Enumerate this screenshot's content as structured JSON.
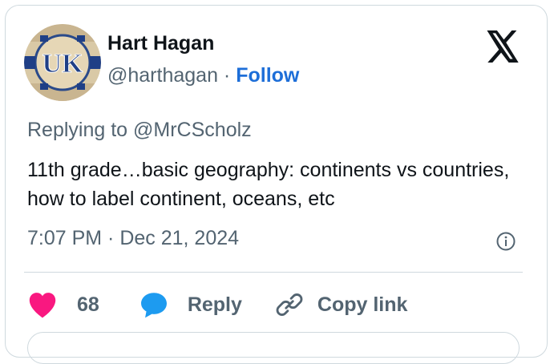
{
  "author": {
    "name": "Hart Hagan",
    "handle": "@harthagan",
    "separator": " · ",
    "follow_label": "Follow",
    "avatar_text": "UK"
  },
  "logo_icon": "x-logo-icon",
  "reply_context": {
    "prefix": "Replying to ",
    "mention": "@MrCScholz"
  },
  "tweet": {
    "text": "11th grade…basic geography: continents vs countries, how to label continent, oceans, etc",
    "timestamp": "7:07 PM · Dec 21, 2024"
  },
  "actions": {
    "like_count": "68",
    "reply_label": "Reply",
    "copy_label": "Copy link"
  },
  "colors": {
    "like": "#f91880",
    "reply": "#1d9bf0",
    "follow": "#1d6ed8",
    "muted": "#536471",
    "border": "#cfd9de"
  }
}
